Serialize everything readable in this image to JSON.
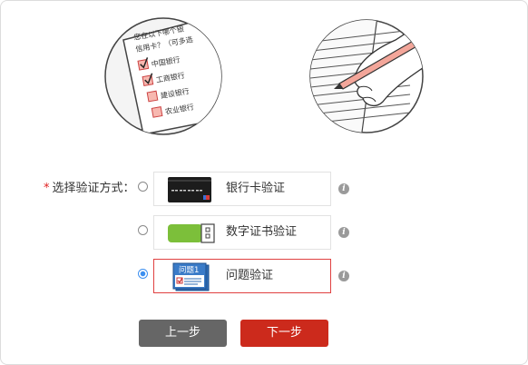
{
  "illustration_left": {
    "question_line1": "您在以下哪个银",
    "question_line2": "信用卡？（可多选",
    "banks": [
      "中国银行",
      "工商银行",
      "建设银行",
      "农业银行"
    ]
  },
  "form": {
    "required_mark": "*",
    "method_label": "选择验证方式：",
    "options": [
      {
        "label": "银行卡验证",
        "icon": "bank-card-icon",
        "selected": false
      },
      {
        "label": "数字证书验证",
        "icon": "usb-key-icon",
        "selected": false
      },
      {
        "label": "问题验证",
        "icon": "question-doc-icon",
        "icon_text": "问题1",
        "selected": true
      }
    ],
    "info_glyph": "i"
  },
  "buttons": {
    "prev_label": "上一步",
    "next_label": "下一步"
  },
  "colors": {
    "accent_red": "#cc2a1c",
    "selected_radio": "#3c8ff0",
    "usb_green": "#7cbf3a",
    "doc_blue": "#2f6db5"
  }
}
